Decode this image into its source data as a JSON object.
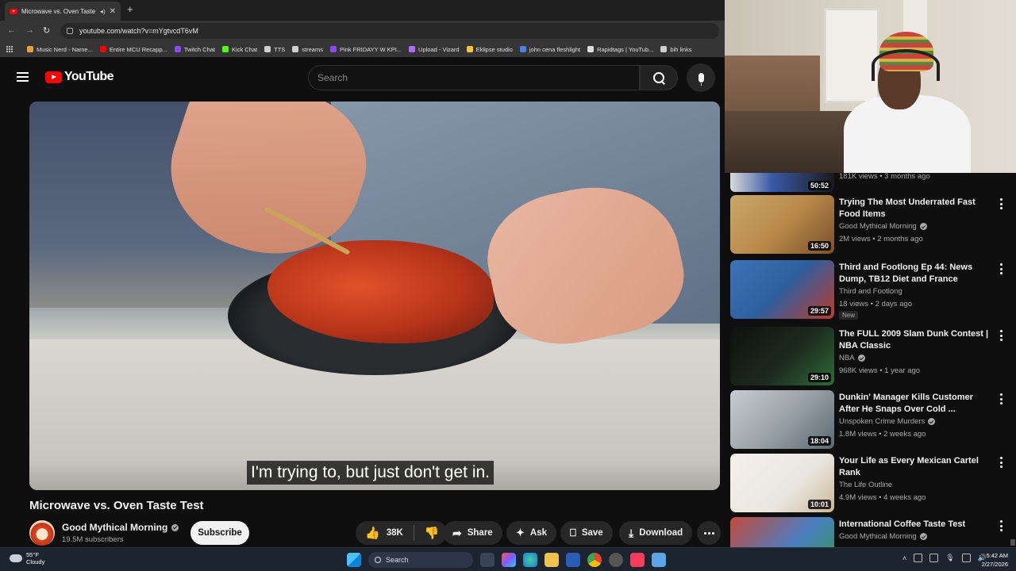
{
  "browser": {
    "tab_title": "Microwave vs. Oven Taste Te",
    "url": "youtube.com/watch?v=mYgtvcdT6vM",
    "bookmarks": [
      {
        "label": "Music Nerd - Name...",
        "color": "#e9a23b"
      },
      {
        "label": "Entire MCU Recapp...",
        "color": "#ff0000"
      },
      {
        "label": "Twitch Chat",
        "color": "#9146ff"
      },
      {
        "label": "Kick Chat",
        "color": "#53fc18"
      },
      {
        "label": "TTS",
        "color": "#cfcfcf"
      },
      {
        "label": "streams",
        "color": "#cfcfcf"
      },
      {
        "label": "Pink FRIDAYY W KPI...",
        "color": "#9146ff"
      },
      {
        "label": "Upload - Vizard",
        "color": "#b26bff"
      },
      {
        "label": "Eklipse studio",
        "color": "#f6c53b"
      },
      {
        "label": "john cena fleshlight",
        "color": "#4a7fe8"
      },
      {
        "label": "Rapidtags | YouTub...",
        "color": "#dddddd"
      },
      {
        "label": "bih links",
        "color": "#cfcfcf"
      }
    ]
  },
  "youtube": {
    "logo_text": "YouTube",
    "search_placeholder": "Search"
  },
  "video": {
    "caption": "I'm trying to, but just don't get in.",
    "title": "Microwave vs. Oven Taste Test",
    "channel": "Good Mythical Morning",
    "subscribers": "19.5M subscribers",
    "subscribe_label": "Subscribe",
    "likes": "38K",
    "share_label": "Share",
    "ask_label": "Ask",
    "save_label": "Save",
    "download_label": "Download"
  },
  "recommendations": {
    "top_partial": {
      "meta": "181K views • 3 months ago",
      "duration": "50:52"
    },
    "items": [
      {
        "title": "Trying The Most Underrated Fast Food Items",
        "channel": "Good Mythical Morning",
        "verified": true,
        "meta": "2M views • 2 months ago",
        "duration": "16:50",
        "thumb_color": "#b98a4a",
        "badge": ""
      },
      {
        "title": "Third and Footlong Ep 44: News Dump, TB12 Diet and France",
        "channel": "Third and Footlong",
        "verified": false,
        "meta": "18 views • 2 days ago",
        "duration": "29:57",
        "thumb_color": "#2f5f9e",
        "badge": "New"
      },
      {
        "title": "The FULL 2009 Slam Dunk Contest | NBA Classic",
        "channel": "NBA",
        "verified": true,
        "meta": "968K views • 1 year ago",
        "duration": "29:10",
        "thumb_color": "#1c2a1e",
        "badge": ""
      },
      {
        "title": "Dunkin' Manager Kills Customer After He Snaps Over Cold ...",
        "channel": "Unspoken Crime Murders",
        "verified": true,
        "meta": "1.8M views • 2 weeks ago",
        "duration": "18:04",
        "thumb_color": "#9aa3a8",
        "badge": ""
      },
      {
        "title": "Your Life as Every Mexican Cartel Rank",
        "channel": "The Life Outline",
        "verified": false,
        "meta": "4.9M views • 4 weeks ago",
        "duration": "10:01",
        "thumb_color": "#e9e5df",
        "badge": ""
      },
      {
        "title": "International Coffee Taste Test",
        "channel": "Good Mythical Morning",
        "verified": true,
        "meta": "",
        "duration": "",
        "thumb_color": "#4a7ec0",
        "badge": ""
      }
    ]
  },
  "taskbar": {
    "temperature": "55°F",
    "condition": "Cloudy",
    "search_label": "Search",
    "time": "5:42 AM",
    "date": "2/27/2026"
  }
}
